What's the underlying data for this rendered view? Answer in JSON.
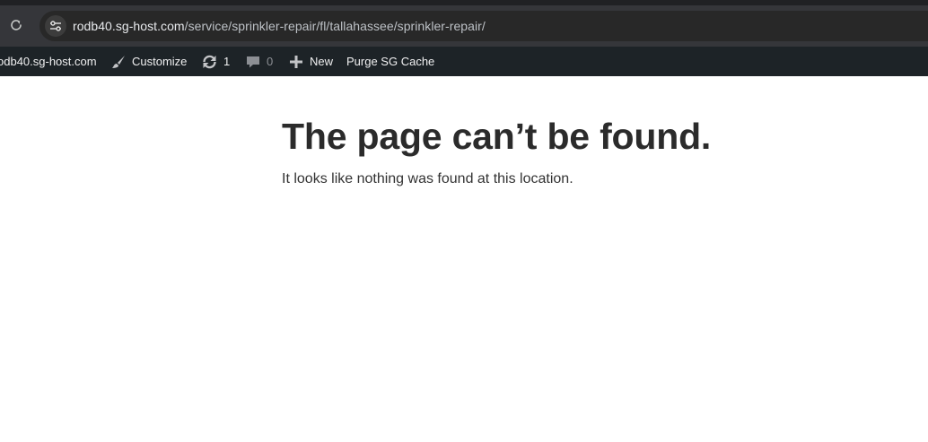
{
  "browser": {
    "url_host": "rodb40.sg-host.com",
    "url_path": "/service/sprinkler-repair/fl/tallahassee/sprinkler-repair/",
    "icons": {
      "reload": "reload-icon",
      "site_info": "site-settings-icon"
    }
  },
  "admin_bar": {
    "site_name": "odb40.sg-host.com",
    "customize_label": "Customize",
    "updates_count": "1",
    "comments_count": "0",
    "new_label": "New",
    "purge_label": "Purge SG Cache",
    "icons": {
      "customize": "paintbrush-icon",
      "updates": "refresh-icon",
      "comments": "comment-bubble-icon",
      "new": "plus-icon"
    }
  },
  "page": {
    "title": "The page can’t be found.",
    "message": "It looks like nothing was found at this location."
  },
  "colors": {
    "browser_chrome": "#35363a",
    "omnibox": "#282828",
    "admin_bar": "#1d2327",
    "admin_bar_text": "#f0f0f1",
    "title_text": "#2b2b2b",
    "body_text": "#333333"
  }
}
